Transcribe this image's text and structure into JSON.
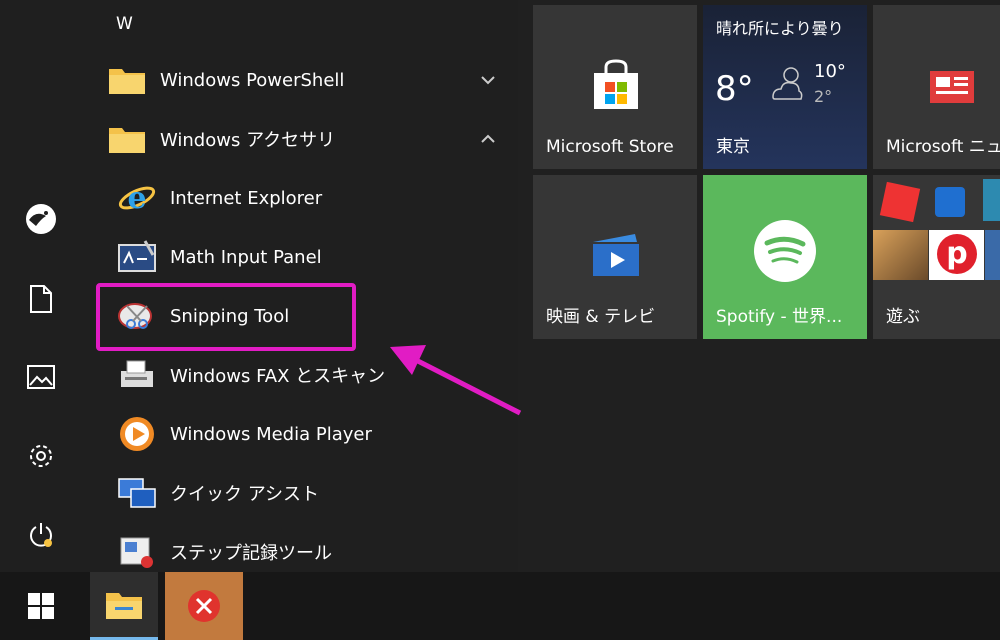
{
  "start_menu": {
    "section_letter": "W",
    "apps": [
      {
        "label": "Windows PowerShell"
      },
      {
        "label": "Windows アクセサリ"
      },
      {
        "label": "Internet Explorer"
      },
      {
        "label": "Math Input Panel"
      },
      {
        "label": "Snipping Tool"
      },
      {
        "label": "Windows FAX とスキャン"
      },
      {
        "label": "Windows Media Player"
      },
      {
        "label": "クイック アシスト"
      },
      {
        "label": "ステップ記録ツール"
      }
    ]
  },
  "tiles": {
    "store": {
      "label": "Microsoft Store"
    },
    "weather": {
      "condition": "晴れ所により曇り",
      "temp": "8°",
      "high": "10°",
      "low": "2°",
      "city": "東京"
    },
    "news": {
      "label": "Microsoft ニュ"
    },
    "movies": {
      "label": "映画 & テレビ"
    },
    "spotify": {
      "label": "Spotify - 世界..."
    },
    "play": {
      "label": "遊ぶ"
    }
  },
  "colors": {
    "highlight": "#e11cc4",
    "spotify_tile": "#5bb85c",
    "weather_tile": "#1e2a44"
  }
}
